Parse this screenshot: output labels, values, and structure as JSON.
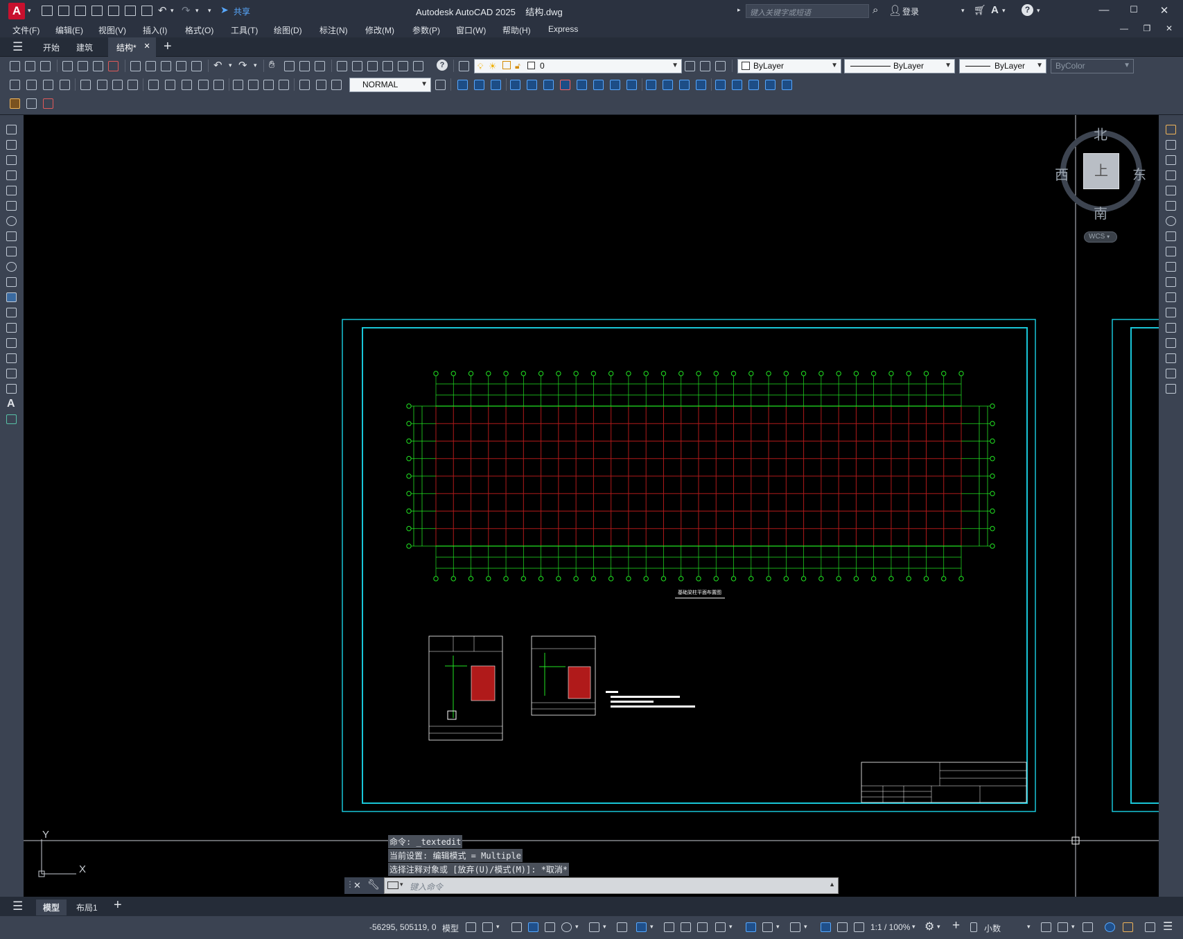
{
  "app": {
    "title": "Autodesk AutoCAD 2025",
    "file": "结构.dwg",
    "share_label": "共享",
    "search_placeholder": "键入关键字或短语",
    "login_label": "登录"
  },
  "menus": [
    "文件(F)",
    "编辑(E)",
    "视图(V)",
    "插入(I)",
    "格式(O)",
    "工具(T)",
    "绘图(D)",
    "标注(N)",
    "修改(M)",
    "参数(P)",
    "窗口(W)",
    "帮助(H)",
    "Express"
  ],
  "doc_tabs": [
    {
      "label": "开始",
      "active": false
    },
    {
      "label": "建筑",
      "active": false
    },
    {
      "label": "结构*",
      "active": true
    }
  ],
  "toolbar": {
    "layer_value": "0",
    "color_value": "ByLayer",
    "linetype_value": "ByLayer",
    "lineweight_value": "ByLayer",
    "plotstyle_value": "ByColor",
    "dimstyle_value": "NORMAL"
  },
  "viewcube": {
    "north": "北",
    "south": "南",
    "east": "东",
    "west": "西",
    "face": "上",
    "wcs": "WCS"
  },
  "ucs": {
    "x": "X",
    "y": "Y"
  },
  "drawing": {
    "plan_title": "基础梁柱平面布置图"
  },
  "command": {
    "history": [
      "命令: _textedit",
      "当前设置: 编辑模式 = Multiple",
      "选择注释对象或 [放弃(U)/模式(M)]: *取消*"
    ],
    "placeholder": "键入命令"
  },
  "layout_tabs": [
    {
      "label": "模型",
      "active": true
    },
    {
      "label": "布局1",
      "active": false
    }
  ],
  "status": {
    "coords": "-56295, 505119, 0",
    "space": "模型",
    "scale": "1:1 / 100%",
    "units": "小数"
  },
  "colors": {
    "grid_red": "#b01a1a",
    "grid_green": "#22e422",
    "frame_cyan": "#19c6d8",
    "title_bg": "#2b3240",
    "toolbar_bg": "#3b4352"
  }
}
